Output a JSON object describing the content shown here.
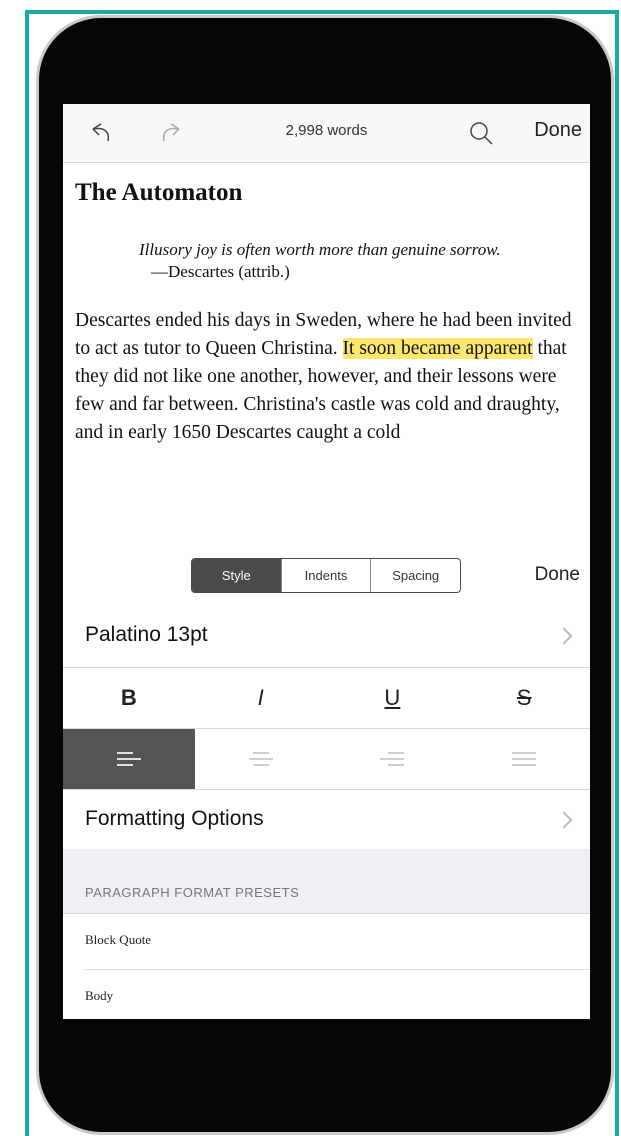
{
  "toolbar": {
    "undo_icon": "undo-icon",
    "redo_icon": "redo-icon",
    "word_count": "2,998 words",
    "search_icon": "search-icon",
    "done_label": "Done"
  },
  "document": {
    "title": "The Automaton",
    "epigraph_quote": "Illusory joy is often worth more than genuine sorrow.",
    "epigraph_attribution": "—Descartes (attrib.)",
    "body_before": "Descartes ended his days in Sweden, where he had been invited to act as tutor to Queen Christina. ",
    "body_highlight": "It soon became apparent",
    "body_after": " that they did not like one another, however, and their lessons were few and far between. Christina's castle was cold and draughty, and in early 1650 Descartes caught a cold",
    "highlight_color": "#fce86e"
  },
  "format_tabs": {
    "tabs": [
      "Style",
      "Indents",
      "Spacing"
    ],
    "active": "Style",
    "done_label": "Done"
  },
  "font_row": {
    "label": "Palatino 13pt"
  },
  "text_styles": [
    "B",
    "I",
    "U",
    "S"
  ],
  "alignment": {
    "options": [
      "left",
      "center",
      "right",
      "justify"
    ],
    "active": "left"
  },
  "formatting_options": {
    "label": "Formatting Options"
  },
  "presets": {
    "header": "PARAGRAPH FORMAT PRESETS",
    "items": [
      "Block Quote",
      "Body"
    ]
  },
  "colors": {
    "accent_border": "#1aaaa8",
    "active_segment": "#4a4a4a",
    "phone_body": "#060606"
  }
}
